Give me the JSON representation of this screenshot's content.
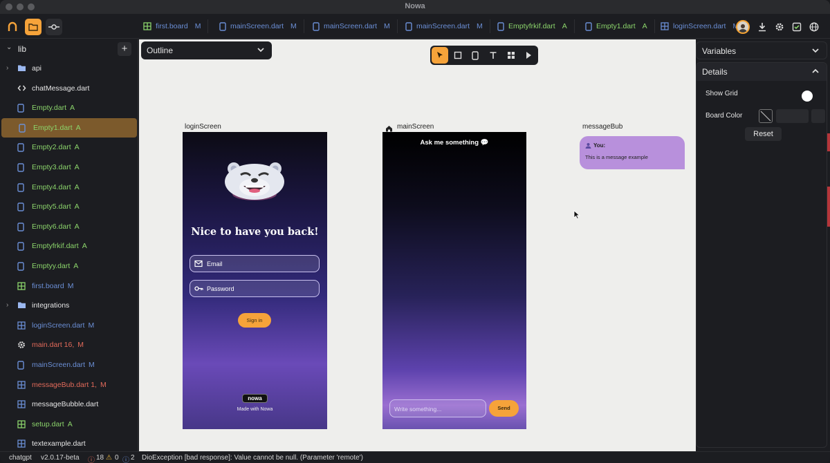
{
  "window": {
    "title": "Nowa"
  },
  "colors": {
    "accent": "#f6a33a",
    "modified": "#6b8fd6",
    "added": "#8bd46b",
    "error": "#e26a5a"
  },
  "tabs": [
    {
      "label": "first.board",
      "status": "M",
      "icon": "grid-icon"
    },
    {
      "label": "mainScreen.dart",
      "status": "M",
      "icon": "phone-icon"
    },
    {
      "label": "mainScreen.dart",
      "status": "M",
      "icon": "phone-icon"
    },
    {
      "label": "mainScreen.dart",
      "status": "M",
      "icon": "phone-icon"
    },
    {
      "label": "Emptyfrkif.dart",
      "status": "A",
      "icon": "phone-icon"
    },
    {
      "label": "Empty1.dart",
      "status": "A",
      "icon": "phone-icon"
    },
    {
      "label": "loginScreen.dart",
      "status": "M",
      "icon": "grid-icon"
    }
  ],
  "sidebar": {
    "root_label": "lib",
    "items": [
      {
        "name": "api",
        "status": "",
        "icon": "folder-icon",
        "expandable": true
      },
      {
        "name": "chatMessage.dart",
        "status": "",
        "icon": "code-icon",
        "expandable": false
      },
      {
        "name": "Empty.dart",
        "status": "A",
        "icon": "phone-icon",
        "expandable": false
      },
      {
        "name": "Empty1.dart",
        "status": "A",
        "icon": "phone-icon",
        "expandable": false,
        "active": true
      },
      {
        "name": "Empty2.dart",
        "status": "A",
        "icon": "phone-icon",
        "expandable": false
      },
      {
        "name": "Empty3.dart",
        "status": "A",
        "icon": "phone-icon",
        "expandable": false
      },
      {
        "name": "Empty4.dart",
        "status": "A",
        "icon": "phone-icon",
        "expandable": false
      },
      {
        "name": "Empty5.dart",
        "status": "A",
        "icon": "phone-icon",
        "expandable": false
      },
      {
        "name": "Empty6.dart",
        "status": "A",
        "icon": "phone-icon",
        "expandable": false
      },
      {
        "name": "Emptyfrkif.dart",
        "status": "A",
        "icon": "phone-icon",
        "expandable": false
      },
      {
        "name": "Emptyy.dart",
        "status": "A",
        "icon": "phone-icon",
        "expandable": false
      },
      {
        "name": "first.board",
        "status": "M",
        "icon": "grid-icon",
        "expandable": false
      },
      {
        "name": "integrations",
        "status": "",
        "icon": "folder-icon",
        "expandable": true
      },
      {
        "name": "loginScreen.dart",
        "status": "M",
        "icon": "grid-icon",
        "expandable": false
      },
      {
        "name": "main.dart 16,",
        "status": "M",
        "icon": "gear-icon",
        "expandable": false
      },
      {
        "name": "mainScreen.dart",
        "status": "M",
        "icon": "phone-icon",
        "expandable": false
      },
      {
        "name": "messageBub.dart 1,",
        "status": "M",
        "icon": "grid-icon",
        "expandable": false
      },
      {
        "name": "messageBubble.dart",
        "status": "",
        "icon": "grid-icon",
        "expandable": false
      },
      {
        "name": "setup.dart",
        "status": "A",
        "icon": "grid-icon",
        "expandable": false
      },
      {
        "name": "textexample.dart",
        "status": "",
        "icon": "grid-icon",
        "expandable": false
      }
    ]
  },
  "canvas": {
    "outline_label": "Outline",
    "frames": {
      "login": {
        "label": "loginScreen",
        "title": "Nice to have you back!",
        "email_placeholder": "Email",
        "password_placeholder": "Password",
        "signin_label": "Sign in",
        "badge": "nowa",
        "footer": "Made with Nowa"
      },
      "main": {
        "label": "mainScreen",
        "heading": "Ask me something 💬",
        "input_placeholder": "Write something...",
        "send_label": "Send"
      },
      "bubble": {
        "label": "messageBub",
        "sender": "You:",
        "message": "This is a message example"
      }
    }
  },
  "right_panel": {
    "variables_label": "Variables",
    "details_label": "Details",
    "show_grid_label": "Show Grid",
    "show_grid_on": true,
    "board_color_label": "Board Color",
    "reset_label": "Reset"
  },
  "statusbar": {
    "project": "chatgpt",
    "version": "v2.0.17-beta",
    "errors": "18",
    "warnings": "0",
    "infos": "2",
    "message": "DioException [bad response]: Value cannot be null. (Parameter 'remote')"
  }
}
